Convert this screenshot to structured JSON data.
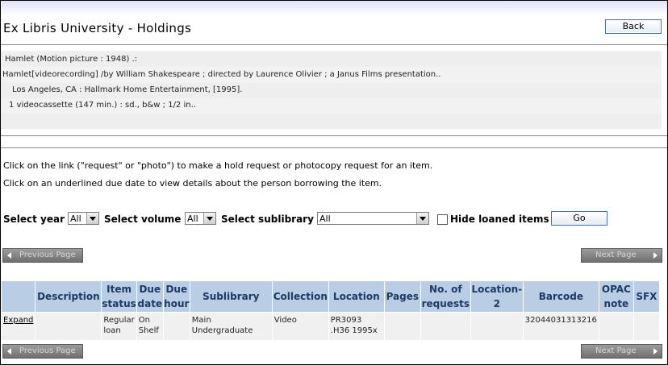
{
  "page": {
    "title": "Ex Libris University - Holdings",
    "back_label": "Back"
  },
  "bib": {
    "lines": [
      "Hamlet (Motion picture : 1948) .:",
      "Hamlet[videorecording] /by William Shakespeare ; directed by Laurence Olivier ; a Janus Films presentation..",
      "Los Angeles, CA : Hallmark Home Entertainment, [1995].",
      "1 videocassette (147 min.) :  sd., b&w ;  1/2 in.."
    ]
  },
  "instructions": {
    "line1": "Click on the link (\"request\" or \"photo\") to make a hold request or photocopy request for an item.",
    "line2": "Click on an underlined due date to view details about the person borrowing the item."
  },
  "filters": {
    "year_label": "Select year",
    "year_value": "All",
    "volume_label": "Select volume",
    "volume_value": "All",
    "sublibrary_label": "Select sublibrary",
    "sublibrary_value": "All",
    "hide_loaned_label": "Hide loaned items",
    "go_label": "Go"
  },
  "pager": {
    "prev": "Previous Page",
    "next": "Next Page"
  },
  "table": {
    "headers": [
      "",
      "Description",
      "Item status",
      "Due date",
      "Due hour",
      "Sublibrary",
      "Collection",
      "Location",
      "Pages",
      "No. of requests",
      "Location-2",
      "Barcode",
      "OPAC note",
      "SFX"
    ],
    "row": {
      "expand": "Expand",
      "description": "",
      "item_status": "Regular loan",
      "due_date": "On Shelf",
      "due_hour": "",
      "sublibrary": "Main Undergraduate",
      "collection": "Video",
      "location": "PR3093 .H36 1995x",
      "pages": "",
      "requests": "",
      "location2": "",
      "barcode": "32044031313216",
      "opac_note": "",
      "sfx": ""
    }
  },
  "colors": {
    "header_bg": "#b9cde5",
    "header_text": "#1d3a63",
    "pager_bg": "#7f7f7f"
  }
}
